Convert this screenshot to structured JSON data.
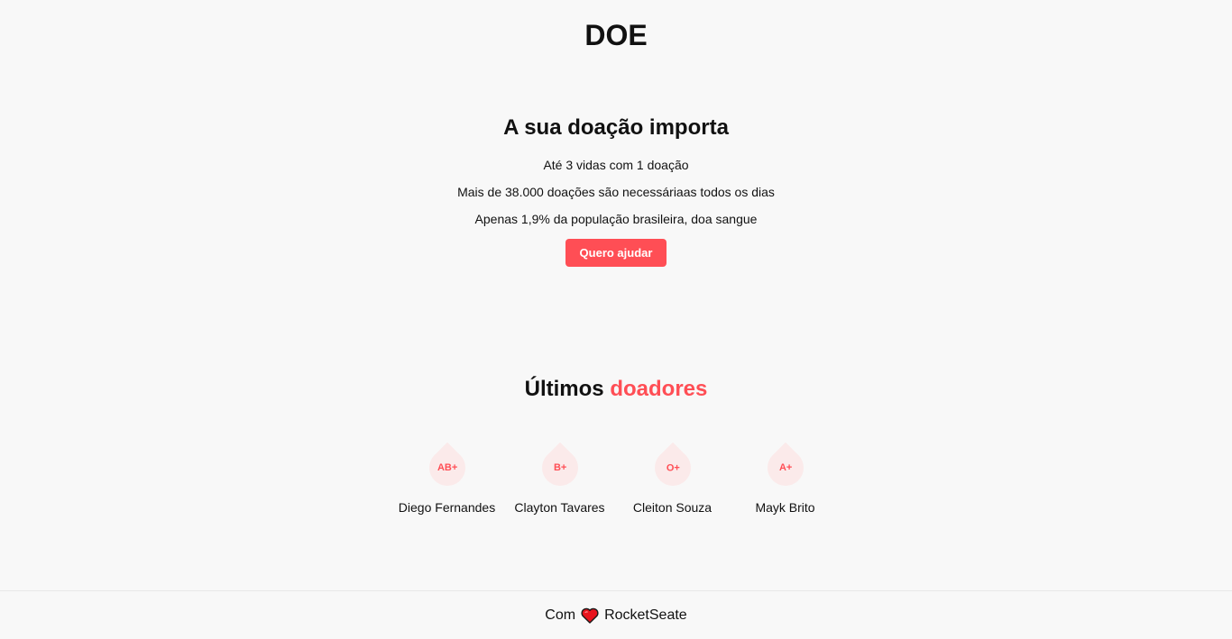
{
  "header": {
    "title": "DOE"
  },
  "intro": {
    "title": "A sua doação importa",
    "lines": [
      "Até 3 vidas com 1 doação",
      "Mais de 38.000 doações são necessáriaas todos os dias",
      "Apenas 1,9% da população brasileira, doa sangue"
    ],
    "button_label": "Quero ajudar"
  },
  "donors_section": {
    "title_prefix": "Últimos",
    "title_accent": "doadores",
    "donors": [
      {
        "blood": "AB+",
        "name": "Diego Fernandes"
      },
      {
        "blood": "B+",
        "name": "Clayton Tavares"
      },
      {
        "blood": "O+",
        "name": "Cleiton Souza"
      },
      {
        "blood": "A+",
        "name": "Mayk Brito"
      }
    ]
  },
  "footer": {
    "prefix": "Com",
    "icon": "heart-icon",
    "suffix": "RocketSeate"
  },
  "colors": {
    "accent": "#ff4e55",
    "drop_bg": "#fbeaea",
    "background": "#f8f8f8"
  }
}
